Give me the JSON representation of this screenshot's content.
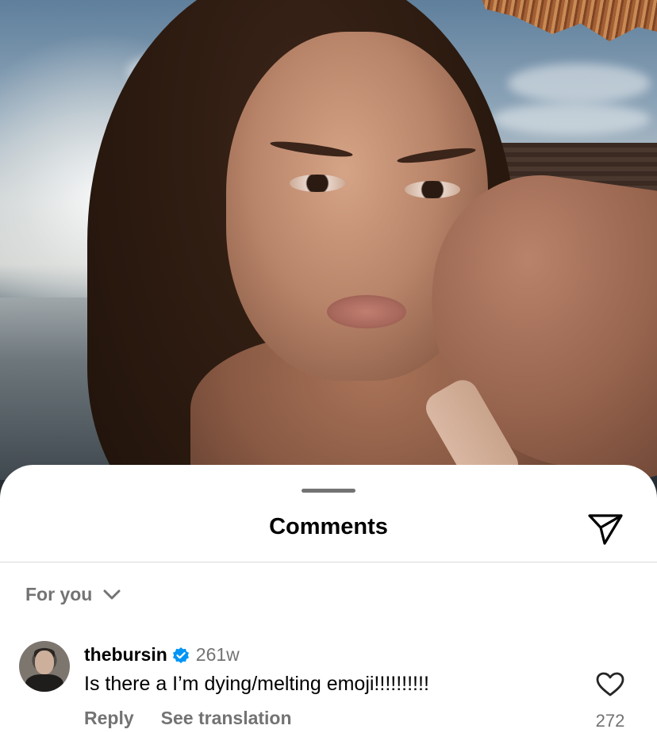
{
  "sheet": {
    "title": "Comments",
    "filter_label": "For you"
  },
  "comments": [
    {
      "username": "thebursin",
      "verified": true,
      "age": "261w",
      "text": "Is there a I’m dying/melting emoji!!!!!!!!!!",
      "reply_label": "Reply",
      "translate_label": "See translation",
      "like_count": "272"
    }
  ],
  "colors": {
    "sheet_bg": "#ffffff",
    "muted_text": "#737373",
    "verified_blue": "#0095f6",
    "divider": "#dbdbdb"
  },
  "icons": {
    "share": "paper-plane-icon",
    "filter": "chevron-down-icon",
    "verified": "verified-badge-icon",
    "like": "heart-outline-icon"
  }
}
